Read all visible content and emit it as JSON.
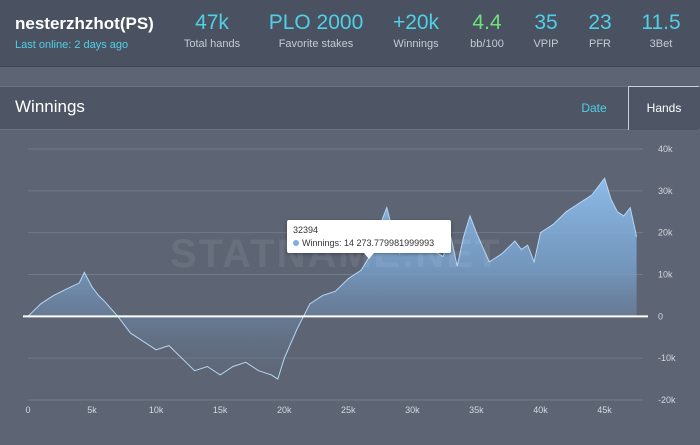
{
  "player": {
    "name": "nesterzhzhot(PS)",
    "last_online": "Last online: 2 days ago"
  },
  "stats": [
    {
      "value": "47k",
      "label": "Total hands"
    },
    {
      "value": "PLO 2000",
      "label": "Favorite stakes"
    },
    {
      "value": "+20k",
      "label": "Winnings"
    },
    {
      "value": "4.4",
      "label": "bb/100"
    },
    {
      "value": "35",
      "label": "VPIP"
    },
    {
      "value": "23",
      "label": "PFR"
    },
    {
      "value": "11.5",
      "label": "3Bet"
    }
  ],
  "panel": {
    "title": "Winnings",
    "tabs": {
      "date": "Date",
      "hands": "Hands"
    },
    "active_tab": "Hands"
  },
  "watermark": "STATNAME.NET",
  "tooltip": {
    "x_value": "32394",
    "series": "Winnings",
    "value_text": "Winnings: 14 273.779981999993"
  },
  "colors": {
    "accent": "#4fd0e6",
    "positive": "#6fe07a",
    "area": "#8ab8e8"
  },
  "chart_data": {
    "type": "area",
    "title": "Winnings",
    "xlabel": "",
    "ylabel": "",
    "xlim": [
      0,
      48000
    ],
    "ylim": [
      -20000,
      40000
    ],
    "x_ticks": [
      "0",
      "5k",
      "10k",
      "15k",
      "20k",
      "25k",
      "30k",
      "35k",
      "40k",
      "45k"
    ],
    "x_tick_values": [
      0,
      5000,
      10000,
      15000,
      20000,
      25000,
      30000,
      35000,
      40000,
      45000
    ],
    "y_ticks": [
      "40k",
      "30k",
      "20k",
      "10k",
      "0",
      "-10k",
      "-20k"
    ],
    "y_tick_values": [
      40000,
      30000,
      20000,
      10000,
      0,
      -10000,
      -20000
    ],
    "grid": true,
    "series": [
      {
        "name": "Winnings",
        "x": [
          0,
          1000,
          2000,
          3000,
          4000,
          4400,
          5000,
          5500,
          6000,
          7000,
          7500,
          8000,
          9000,
          10000,
          11000,
          12000,
          13000,
          14000,
          15000,
          16000,
          17000,
          18000,
          19000,
          19500,
          20000,
          21000,
          22000,
          23000,
          24000,
          25000,
          26000,
          27000,
          27500,
          28000,
          28500,
          29000,
          30000,
          31000,
          32394,
          33000,
          33500,
          34000,
          34500,
          35000,
          36000,
          37000,
          38000,
          38500,
          39000,
          39500,
          40000,
          41000,
          42000,
          43000,
          44000,
          44500,
          45000,
          45500,
          46000,
          46500,
          47000,
          47500
        ],
        "y": [
          0,
          3000,
          5000,
          6500,
          8000,
          10500,
          7000,
          5000,
          3500,
          0,
          -2000,
          -4000,
          -6000,
          -8000,
          -7000,
          -10000,
          -13000,
          -12000,
          -14000,
          -12000,
          -11000,
          -13000,
          -14000,
          -15000,
          -10000,
          -3000,
          3000,
          5000,
          6000,
          9000,
          11000,
          16000,
          22000,
          26000,
          20000,
          15000,
          18000,
          17000,
          14274,
          19000,
          12000,
          19000,
          24000,
          20000,
          13000,
          15000,
          18000,
          16000,
          17000,
          13000,
          20000,
          22000,
          25000,
          27000,
          29000,
          31000,
          33000,
          28000,
          25000,
          24000,
          26000,
          19000
        ]
      }
    ]
  }
}
